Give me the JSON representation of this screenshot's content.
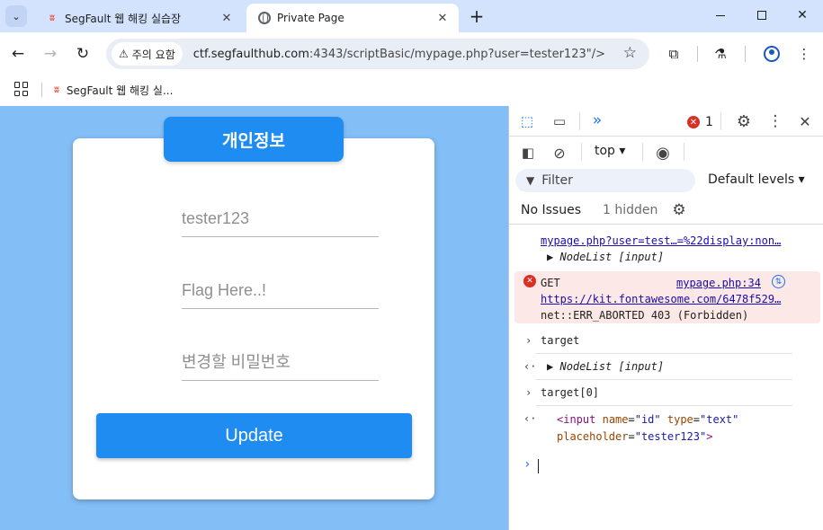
{
  "browser": {
    "tabs": [
      {
        "title": "SegFault 웹 해킹 실습장",
        "active": false,
        "favicon": "segfault-logo-icon"
      },
      {
        "title": "Private Page",
        "active": true,
        "favicon": "globe-icon"
      }
    ],
    "security_label": "주의 요함",
    "url_host": "ctf.segfaulthub.com",
    "url_rest": ":4343/scriptBasic/mypage.php?user=tester123\"/> <...",
    "bookmarks": [
      {
        "label": "SegFault 웹 해킹 실..."
      }
    ]
  },
  "page": {
    "card_title": "개인정보",
    "fields": [
      {
        "placeholder": "tester123",
        "value": ""
      },
      {
        "placeholder": "Flag Here..!",
        "value": ""
      },
      {
        "placeholder": "변경할 비밀번호",
        "value": ""
      }
    ],
    "update_label": "Update",
    "colors": {
      "background": "#84bef6",
      "accent": "#1e8cf0"
    }
  },
  "devtools": {
    "error_count": "1",
    "context": "top ▾",
    "filter_placeholder": "Filter",
    "levels": "Default levels ▾",
    "issues": "No Issues",
    "hidden": "1 hidden",
    "console": {
      "line1_link": "mypage.php?user=test…=%22display:non…",
      "line2": "NodeList [input]",
      "error_method": "GET",
      "error_source": "mypage.php:34",
      "error_url": "https://kit.fontawesome.com/6478f529…",
      "error_msg": "net::ERR_ABORTED 403 (Forbidden)",
      "cmd1": "target",
      "out1": "NodeList [input]",
      "cmd2": "target[0]",
      "out2_tag_open": "<input",
      "out2_name_attr": "name",
      "out2_name_val": "\"id\"",
      "out2_type_attr": "type",
      "out2_type_val": "\"text\"",
      "out2_ph_attr": "placeholder",
      "out2_ph_val": "\"tester123\"",
      "out2_tag_close": ">"
    }
  }
}
